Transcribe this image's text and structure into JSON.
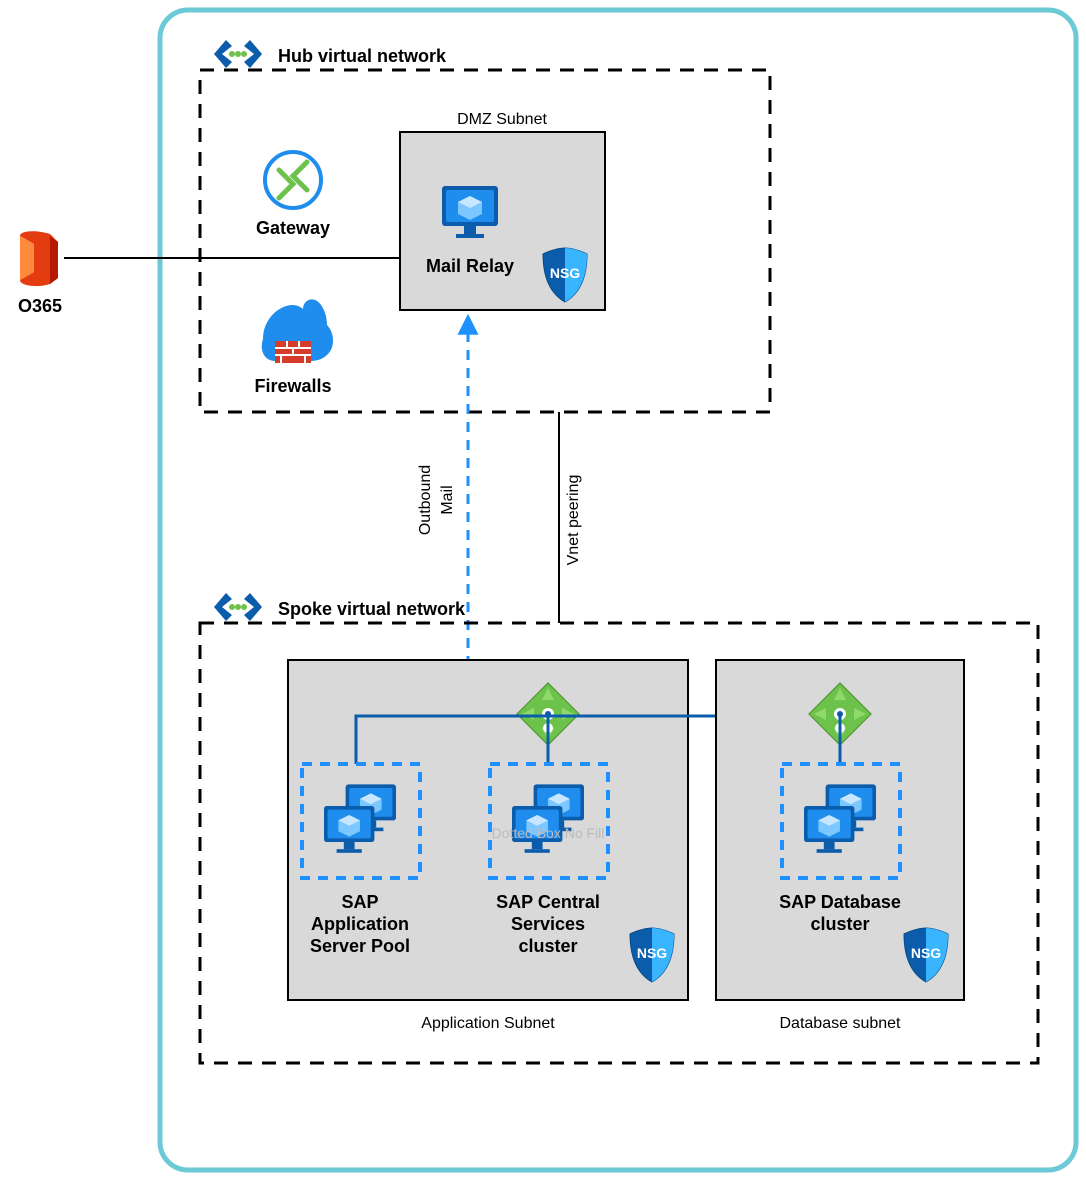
{
  "external": {
    "o365": "O365"
  },
  "hub": {
    "title": "Hub virtual network",
    "gateway": "Gateway",
    "firewalls": "Firewalls",
    "dmz": {
      "title": "DMZ Subnet",
      "mailRelay": "Mail Relay",
      "nsg": "NSG"
    }
  },
  "links": {
    "outboundMail": "Outbound Mail",
    "vnetPeering": "Vnet peering"
  },
  "spoke": {
    "title": "Spoke virtual network",
    "appSubnet": {
      "title": "Application Subnet",
      "appPool": "SAP Application Server Pool",
      "centralServices": "SAP Central Services cluster",
      "nsg": "NSG",
      "watermark": "Dotted Box No Fill"
    },
    "dbSubnet": {
      "title": "Database subnet",
      "dbCluster": "SAP Database cluster",
      "nsg": "NSG"
    }
  }
}
